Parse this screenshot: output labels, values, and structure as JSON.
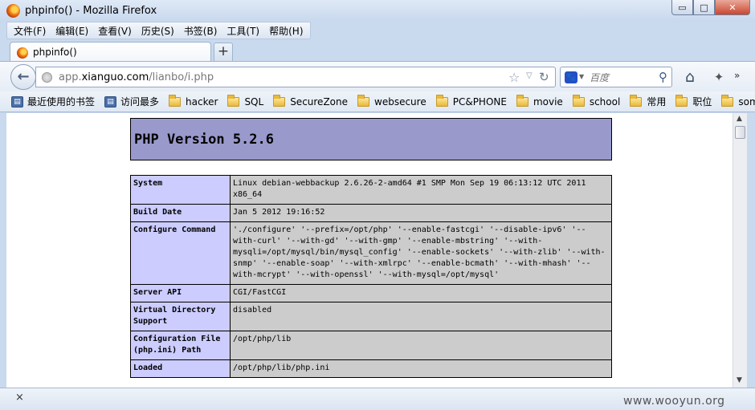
{
  "window": {
    "title": "phpinfo() - Mozilla Firefox",
    "controls": [
      "▭",
      "□",
      "✕"
    ]
  },
  "menu": [
    {
      "label": "文件(F)"
    },
    {
      "label": "编辑(E)"
    },
    {
      "label": "查看(V)"
    },
    {
      "label": "历史(S)"
    },
    {
      "label": "书签(B)"
    },
    {
      "label": "工具(T)"
    },
    {
      "label": "帮助(H)"
    }
  ],
  "tabs": {
    "active_label": "phpinfo()",
    "new_tab_label": "+"
  },
  "nav": {
    "back_glyph": "←",
    "url_prefix": "app.",
    "url_domain": "xianguo.com",
    "url_path": "/lianbo/i.php",
    "star_glyph": "☆",
    "dropdown_glyph": "▽",
    "reload_glyph": "↻",
    "search_engine_glyph": "🐾",
    "search_placeholder": "百度",
    "search_glyph": "⚲",
    "home_glyph": "⌂",
    "addon_glyph": "✦",
    "overflow_glyph": "»"
  },
  "bookmarks": {
    "smart": [
      {
        "label": "最近使用的书签"
      },
      {
        "label": "访问最多"
      }
    ],
    "folders": [
      {
        "label": "hacker"
      },
      {
        "label": "SQL"
      },
      {
        "label": "SecureZone"
      },
      {
        "label": "websecure"
      },
      {
        "label": "PC&PHONE"
      },
      {
        "label": "movie"
      },
      {
        "label": "school"
      },
      {
        "label": "常用"
      },
      {
        "label": "职位"
      },
      {
        "label": "something"
      }
    ]
  },
  "php": {
    "header": "PHP Version 5.2.6",
    "rows": [
      {
        "key": "System",
        "value": "Linux debian-webbackup 2.6.26-2-amd64 #1 SMP Mon Sep 19 06:13:12 UTC 2011 x86_64"
      },
      {
        "key": "Build Date",
        "value": "Jan 5 2012 19:16:52"
      },
      {
        "key": "Configure Command",
        "value": "'./configure' '--prefix=/opt/php' '--enable-fastcgi' '--disable-ipv6' '--with-curl' '--with-gd' '--with-gmp' '--enable-mbstring' '--with-mysqli=/opt/mysql/bin/mysql_config' '--enable-sockets' '--with-zlib' '--with-snmp' '--enable-soap' '--with-xmlrpc' '--enable-bcmath' '--with-mhash' '--with-mcrypt' '--with-openssl' '--with-mysql=/opt/mysql'"
      },
      {
        "key": "Server API",
        "value": "CGI/FastCGI"
      },
      {
        "key": "Virtual Directory Support",
        "value": "disabled"
      },
      {
        "key": "Configuration File (php.ini) Path",
        "value": "/opt/php/lib"
      },
      {
        "key": "Loaded",
        "value": "/opt/php/lib/php.ini"
      }
    ]
  },
  "status": {
    "close_glyph": "×",
    "watermark": "www.wooyun.org"
  },
  "scroll": {
    "up_glyph": "▲",
    "down_glyph": "▼"
  }
}
